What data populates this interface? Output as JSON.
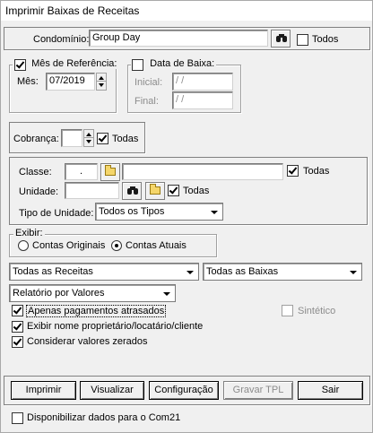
{
  "window": {
    "title": "Imprimir Baixas de Receitas"
  },
  "condominio": {
    "label": "Condomínio:",
    "value": "Group Day",
    "todos_label": "Todos",
    "todos_checked": false
  },
  "mes_ref": {
    "label": "Mês de Referência:",
    "checked": true,
    "mes_label": "Mês:",
    "mes_value": "07/2019"
  },
  "data_baixa": {
    "label": "Data de Baixa:",
    "checked": false,
    "inicial_label": "Inicial:",
    "inicial_value": " / /",
    "final_label": "Final:",
    "final_value": " / /"
  },
  "cobranca": {
    "label": "Cobrança:",
    "value": "",
    "todas_label": "Todas",
    "todas_checked": true
  },
  "classe": {
    "label": "Classe:",
    "code": ".",
    "desc": "",
    "todas_label": "Todas",
    "todas_checked": true
  },
  "unidade": {
    "label": "Unidade:",
    "value": "",
    "todas_label": "Todas",
    "todas_checked": true
  },
  "tipo_unidade": {
    "label": "Tipo de Unidade:",
    "value": "Todos os Tipos"
  },
  "exibir": {
    "label": "Exibir:",
    "opt1": "Contas Originais",
    "opt2": "Contas Atuais",
    "selected": "opt2"
  },
  "receitas_combo": {
    "value": "Todas as Receitas"
  },
  "baixas_combo": {
    "value": "Todas as Baixas"
  },
  "relatorio_combo": {
    "value": "Relatório por Valores"
  },
  "options": {
    "apenas_atrasados": {
      "label": "Apenas pagamentos atrasados",
      "checked": true
    },
    "sintetico": {
      "label": "Sintético",
      "checked": false,
      "disabled": true
    },
    "exibir_nome": {
      "label": "Exibir nome proprietário/locatário/cliente",
      "checked": true
    },
    "considerar_zerados": {
      "label": "Considerar valores zerados",
      "checked": true
    }
  },
  "buttons": {
    "imprimir": "Imprimir",
    "visualizar": "Visualizar",
    "configuracao": "Configuração",
    "gravar_tpl": "Gravar TPL",
    "sair": "Sair"
  },
  "com21": {
    "label": "Disponibilizar dados para o Com21",
    "checked": false
  }
}
